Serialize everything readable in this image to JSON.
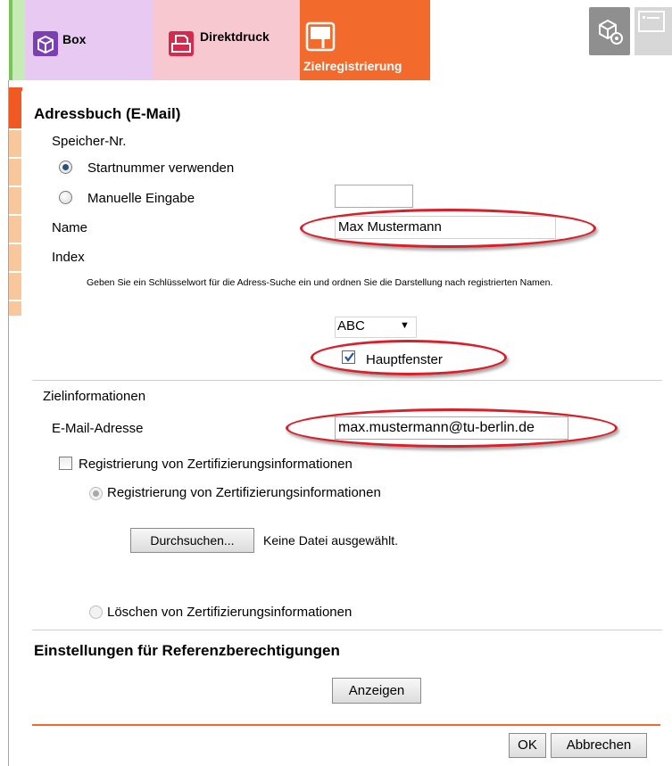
{
  "tabs": {
    "box": "Box",
    "direktdruck": "Direktdruck",
    "zielregistrierung": "Zielregistrierung"
  },
  "section_title": "Adressbuch (E-Mail)",
  "speicher": {
    "label": "Speicher-Nr.",
    "option_start": "Startnummer verwenden",
    "option_manual": "Manuelle Eingabe",
    "selected": "Startnummer verwenden"
  },
  "name": {
    "label": "Name",
    "value": "Max Mustermann"
  },
  "index": {
    "label": "Index",
    "hint": "Geben Sie ein Schlüsselwort für die Adress-Suche ein und ordnen Sie die Darstellung nach registrierten Namen.",
    "select_value": "ABC",
    "hauptfenster_label": "Hauptfenster",
    "hauptfenster_checked": true
  },
  "ziel": {
    "title": "Zielinformationen",
    "email_label": "E-Mail-Adresse",
    "email_value": "max.mustermann@tu-berlin.de",
    "cert_checkbox_label": "Registrierung von Zertifizierungsinformationen",
    "cert_register_label": "Registrierung von Zertifizierungsinformationen",
    "browse_button": "Durchsuchen...",
    "no_file": "Keine Datei ausgewählt.",
    "cert_delete_label": "Löschen von Zertifizierungsinformationen"
  },
  "referenz": {
    "title": "Einstellungen für Referenzberechtigungen",
    "show_button": "Anzeigen"
  },
  "footer": {
    "ok": "OK",
    "cancel": "Abbrechen"
  },
  "colors": {
    "accent": "#f26a2c",
    "highlight": "#d9202a"
  }
}
